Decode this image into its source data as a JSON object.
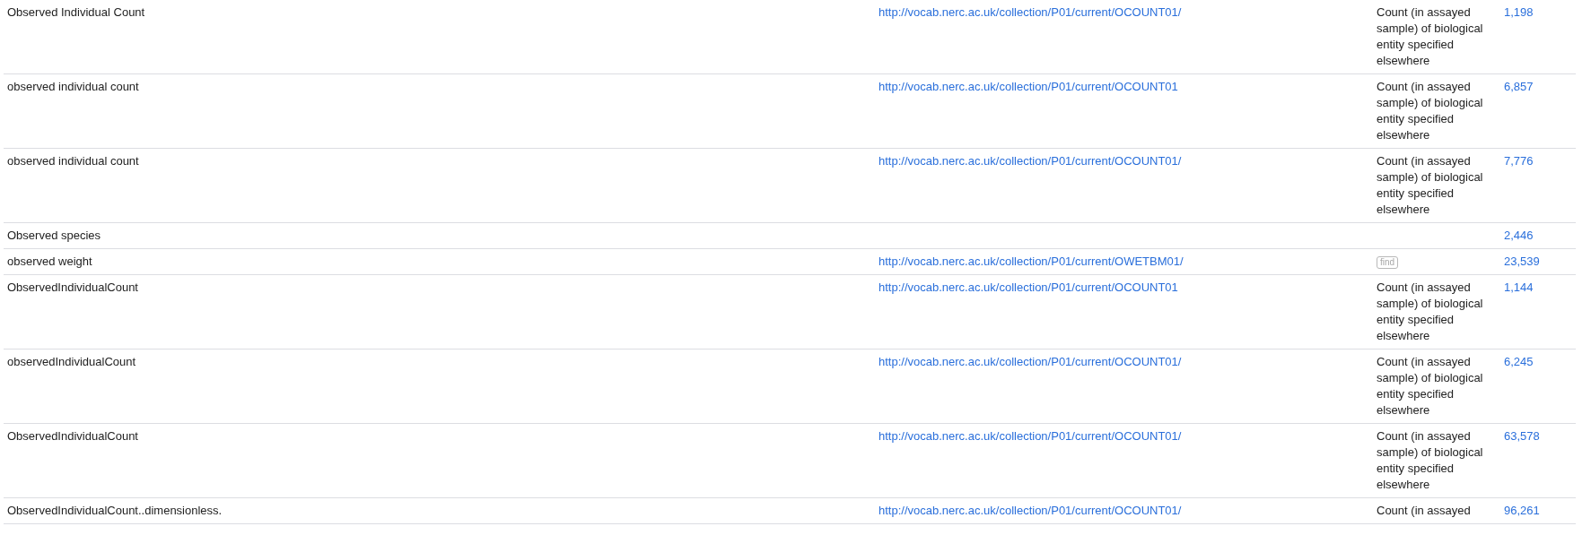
{
  "rows": [
    {
      "name": "Observed Individual Count",
      "url": "http://vocab.nerc.ac.uk/collection/P01/current/OCOUNT01/",
      "description": "Count (in assayed sample) of biological entity specified elsewhere",
      "count": "1,198"
    },
    {
      "name": "observed individual count",
      "url": "http://vocab.nerc.ac.uk/collection/P01/current/OCOUNT01",
      "description": "Count (in assayed sample) of biological entity specified elsewhere",
      "count": "6,857"
    },
    {
      "name": "observed individual count",
      "url": "http://vocab.nerc.ac.uk/collection/P01/current/OCOUNT01/",
      "description": "Count (in assayed sample) of biological entity specified elsewhere",
      "count": "7,776"
    },
    {
      "name": "Observed species",
      "count": "2,446"
    },
    {
      "name": "observed weight",
      "url": "http://vocab.nerc.ac.uk/collection/P01/current/OWETBM01/",
      "find_button": {
        "label": "find",
        "disabled": true
      },
      "count": "23,539"
    },
    {
      "name": "ObservedIndividualCount",
      "url": "http://vocab.nerc.ac.uk/collection/P01/current/OCOUNT01",
      "description": "Count (in assayed sample) of biological entity specified elsewhere",
      "count": "1,144"
    },
    {
      "name": "observedIndividualCount",
      "url": "http://vocab.nerc.ac.uk/collection/P01/current/OCOUNT01/",
      "description": "Count (in assayed sample) of biological entity specified elsewhere",
      "count": "6,245"
    },
    {
      "name": "ObservedIndividualCount",
      "url": "http://vocab.nerc.ac.uk/collection/P01/current/OCOUNT01/",
      "description": "Count (in assayed sample) of biological entity specified elsewhere",
      "count": "63,578"
    },
    {
      "name": "ObservedIndividualCount..dimensionless.",
      "url": "http://vocab.nerc.ac.uk/collection/P01/current/OCOUNT01/",
      "description": "Count (in assayed",
      "count": "96,261"
    }
  ]
}
